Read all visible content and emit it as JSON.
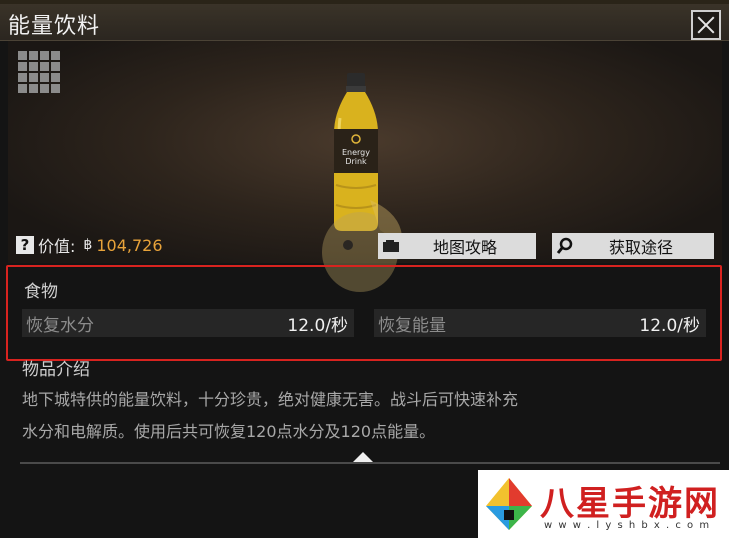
{
  "window": {
    "title": "能量饮料"
  },
  "item": {
    "price_label": "价值:",
    "price_value": "104,726",
    "bottle_text": [
      "Energy",
      "Drink"
    ]
  },
  "buttons": {
    "map_guide": "地图攻略",
    "acquire": "获取途径"
  },
  "stats": {
    "category": "食物",
    "items": [
      {
        "label": "恢复水分",
        "value": "12.0/秒"
      },
      {
        "label": "恢复能量",
        "value": "12.0/秒"
      }
    ]
  },
  "description": {
    "title": "物品介绍",
    "lines": [
      "地下城特供的能量饮料，十分珍贵，绝对健康无害。战斗后可快速补充",
      "水分和电解质。使用后共可恢复120点水分及120点能量。"
    ]
  },
  "watermark": {
    "site": "八星手游网",
    "url": "w w w . l y s h b x . c o m"
  },
  "colors": {
    "accent_price": "#e8a33a",
    "highlight_border": "#d8231f",
    "watermark_red": "#d02020"
  }
}
